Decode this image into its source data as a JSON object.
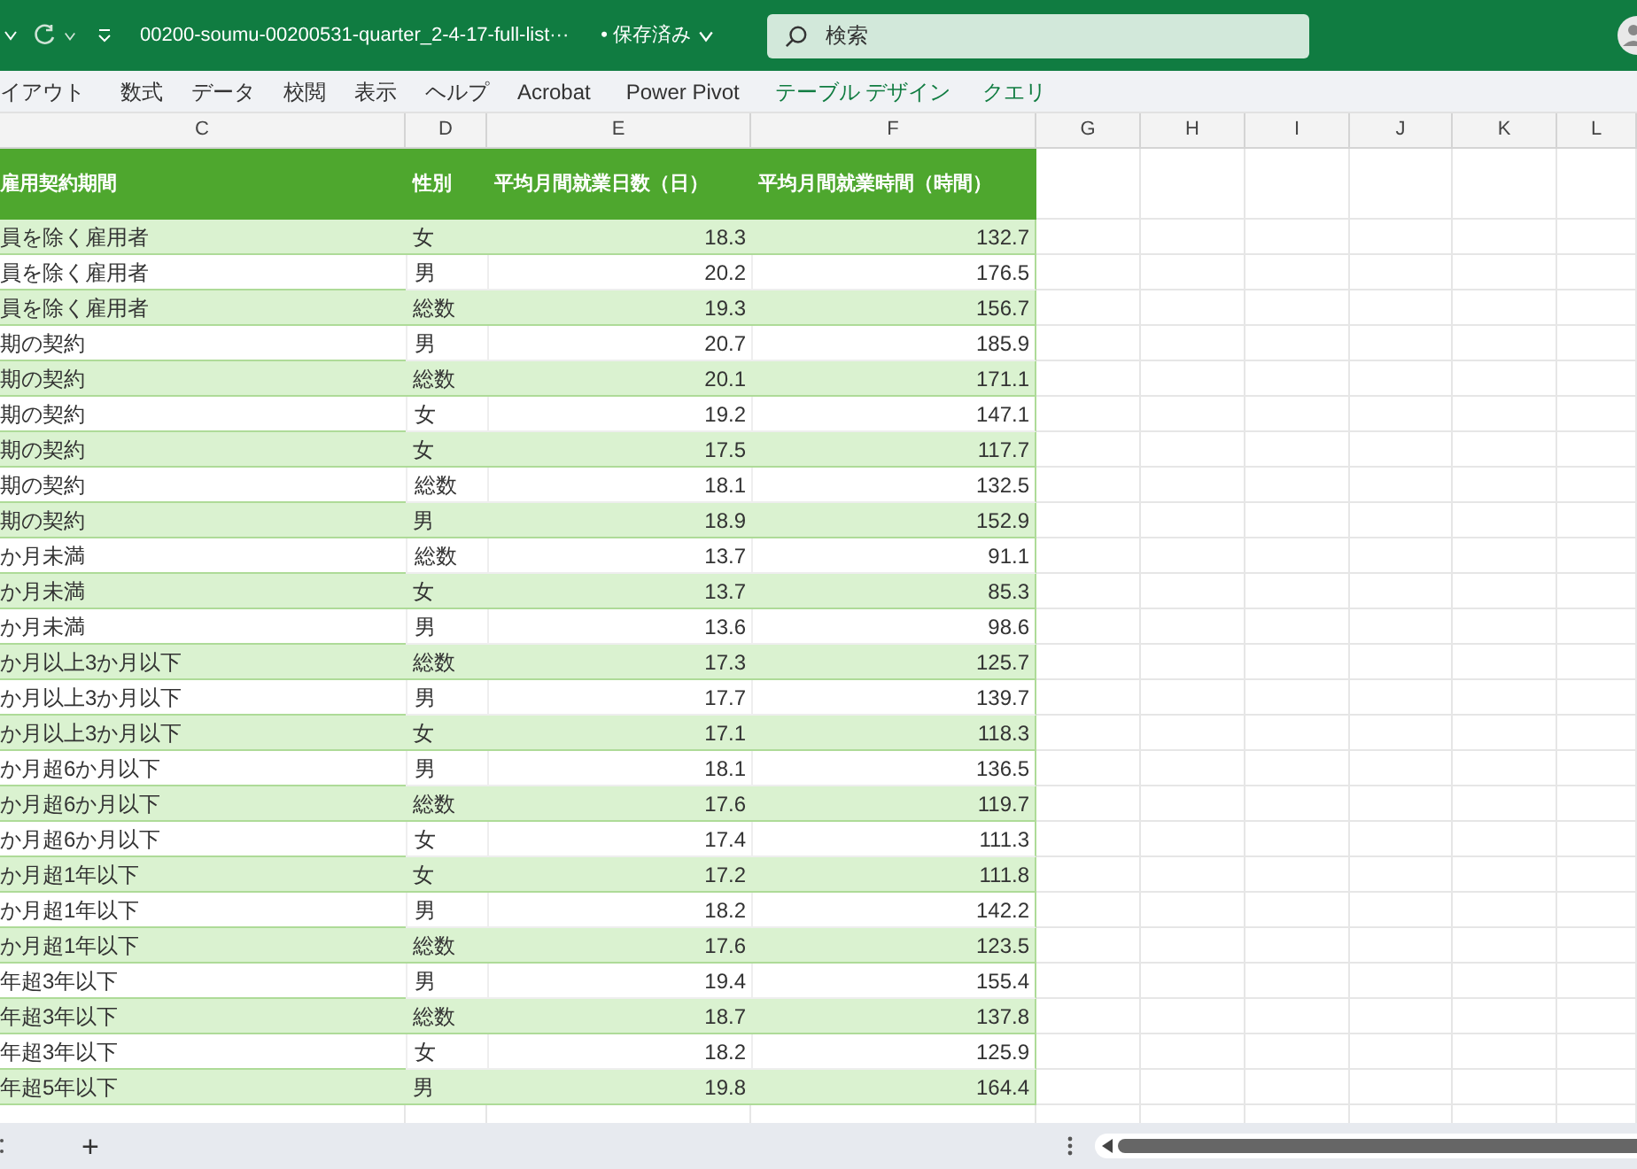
{
  "title_bar": {
    "file_name": "00200-soumu-00200531-quarter_2-4-17-full-list···",
    "save_status": "• 保存済み",
    "search_placeholder": "検索"
  },
  "ribbon_tabs": [
    {
      "label": "イアウト",
      "kind": "normal"
    },
    {
      "label": "数式",
      "kind": "normal"
    },
    {
      "label": "データ",
      "kind": "normal"
    },
    {
      "label": "校閲",
      "kind": "normal"
    },
    {
      "label": "表示",
      "kind": "normal"
    },
    {
      "label": "ヘルプ",
      "kind": "normal"
    },
    {
      "label": "Acrobat",
      "kind": "normal"
    },
    {
      "label": "Power Pivot",
      "kind": "normal"
    },
    {
      "label": "テーブル デザイン",
      "kind": "contextual"
    },
    {
      "label": "クエリ",
      "kind": "contextual"
    }
  ],
  "column_letters": [
    "C",
    "D",
    "E",
    "F",
    "G",
    "H",
    "I",
    "J",
    "K",
    "L"
  ],
  "table": {
    "columns": [
      "雇用契約期間",
      "性別",
      "平均月間就業日数（日）",
      "平均月間就業時間（時間）"
    ],
    "rows": [
      {
        "c": "員を除く雇用者",
        "d": "女",
        "e": "18.3",
        "f": "132.7"
      },
      {
        "c": "員を除く雇用者",
        "d": "男",
        "e": "20.2",
        "f": "176.5"
      },
      {
        "c": "員を除く雇用者",
        "d": "総数",
        "e": "19.3",
        "f": "156.7"
      },
      {
        "c": "期の契約",
        "d": "男",
        "e": "20.7",
        "f": "185.9"
      },
      {
        "c": "期の契約",
        "d": "総数",
        "e": "20.1",
        "f": "171.1"
      },
      {
        "c": "期の契約",
        "d": "女",
        "e": "19.2",
        "f": "147.1"
      },
      {
        "c": "期の契約",
        "d": "女",
        "e": "17.5",
        "f": "117.7"
      },
      {
        "c": "期の契約",
        "d": "総数",
        "e": "18.1",
        "f": "132.5"
      },
      {
        "c": "期の契約",
        "d": "男",
        "e": "18.9",
        "f": "152.9"
      },
      {
        "c": "か月未満",
        "d": "総数",
        "e": "13.7",
        "f": "91.1"
      },
      {
        "c": "か月未満",
        "d": "女",
        "e": "13.7",
        "f": "85.3"
      },
      {
        "c": "か月未満",
        "d": "男",
        "e": "13.6",
        "f": "98.6"
      },
      {
        "c": "か月以上3か月以下",
        "d": "総数",
        "e": "17.3",
        "f": "125.7"
      },
      {
        "c": "か月以上3か月以下",
        "d": "男",
        "e": "17.7",
        "f": "139.7"
      },
      {
        "c": "か月以上3か月以下",
        "d": "女",
        "e": "17.1",
        "f": "118.3"
      },
      {
        "c": "か月超6か月以下",
        "d": "男",
        "e": "18.1",
        "f": "136.5"
      },
      {
        "c": "か月超6か月以下",
        "d": "総数",
        "e": "17.6",
        "f": "119.7"
      },
      {
        "c": "か月超6か月以下",
        "d": "女",
        "e": "17.4",
        "f": "111.3"
      },
      {
        "c": "か月超1年以下",
        "d": "女",
        "e": "17.2",
        "f": "111.8"
      },
      {
        "c": "か月超1年以下",
        "d": "男",
        "e": "18.2",
        "f": "142.2"
      },
      {
        "c": "か月超1年以下",
        "d": "総数",
        "e": "17.6",
        "f": "123.5"
      },
      {
        "c": "年超3年以下",
        "d": "男",
        "e": "19.4",
        "f": "155.4"
      },
      {
        "c": "年超3年以下",
        "d": "総数",
        "e": "18.7",
        "f": "137.8"
      },
      {
        "c": "年超3年以下",
        "d": "女",
        "e": "18.2",
        "f": "125.9"
      },
      {
        "c": "年超5年以下",
        "d": "男",
        "e": "19.8",
        "f": "164.4"
      }
    ]
  },
  "sheet_bar": {
    "add_sheet": "+"
  }
}
